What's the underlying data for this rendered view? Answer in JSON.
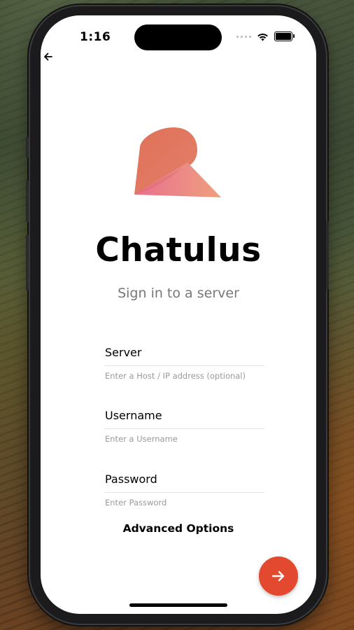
{
  "status_bar": {
    "time": "1:16"
  },
  "app": {
    "title": "Chatulus",
    "subtitle": "Sign in to a server"
  },
  "form": {
    "fields": [
      {
        "label": "Server",
        "value": "",
        "placeholder": "Enter a Host / IP address (optional)"
      },
      {
        "label": "Username",
        "value": "",
        "placeholder": "Enter a Username"
      },
      {
        "label": "Password",
        "value": "",
        "placeholder": "Enter Password"
      }
    ],
    "advanced_label": "Advanced Options"
  },
  "icons": {
    "back": "arrow-left-icon",
    "next": "arrow-right-icon",
    "logo": "chat-bubble-logo",
    "signal": "signal-dots-icon",
    "wifi": "wifi-icon",
    "battery": "battery-icon"
  },
  "colors": {
    "accent": "#e2492f",
    "logo_top": "#e0735c",
    "logo_bottom": "#e97a8f",
    "subtitle": "#777777",
    "placeholder": "#9a9a9a"
  }
}
